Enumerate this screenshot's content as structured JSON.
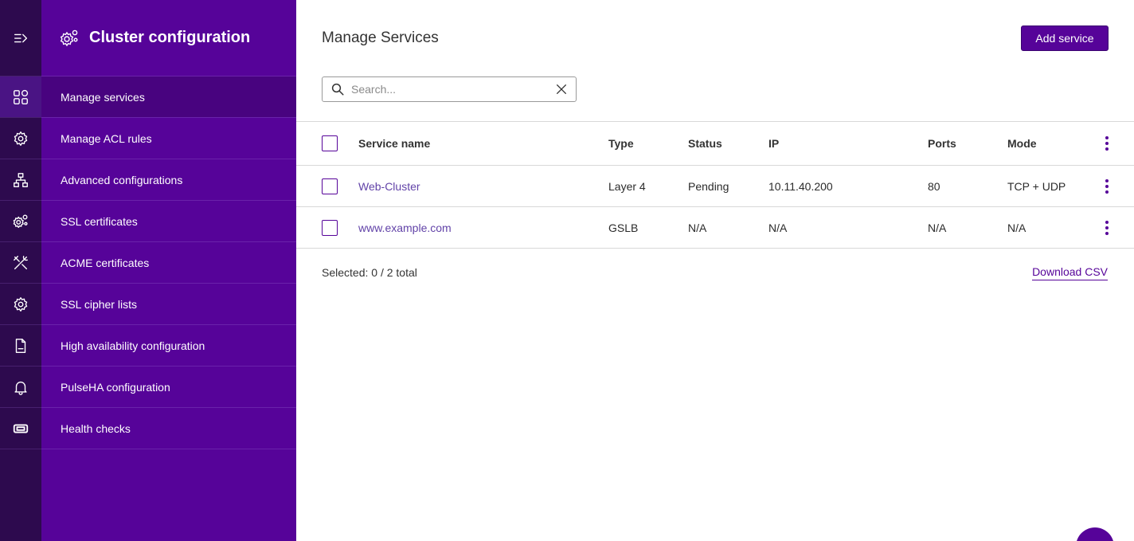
{
  "sidebar": {
    "title": "Cluster configuration",
    "items": [
      {
        "label": "Manage services",
        "icon": "grid-icon",
        "active": true
      },
      {
        "label": "Manage ACL rules",
        "icon": "gear-icon",
        "active": false
      },
      {
        "label": "Advanced configurations",
        "icon": "network-icon",
        "active": false
      },
      {
        "label": "SSL certificates",
        "icon": "gears-icon",
        "active": false
      },
      {
        "label": "ACME certificates",
        "icon": "tools-icon",
        "active": false
      },
      {
        "label": "SSL cipher lists",
        "icon": "cog-icon",
        "active": false
      },
      {
        "label": "High availability configuration",
        "icon": "log-file-icon",
        "active": false
      },
      {
        "label": "PulseHA configuration",
        "icon": "bell-icon",
        "active": false
      },
      {
        "label": "Health checks",
        "icon": "ticket-icon",
        "active": false
      }
    ]
  },
  "main": {
    "title": "Manage Services",
    "add_button": "Add service",
    "search": {
      "placeholder": "Search...",
      "value": ""
    },
    "table": {
      "headers": {
        "name": "Service name",
        "type": "Type",
        "status": "Status",
        "ip": "IP",
        "ports": "Ports",
        "mode": "Mode"
      },
      "rows": [
        {
          "name": "Web-Cluster",
          "type": "Layer 4",
          "status": "Pending",
          "ip": "10.11.40.200",
          "ports": "80",
          "mode": "TCP + UDP"
        },
        {
          "name": "www.example.com",
          "type": "GSLB",
          "status": "N/A",
          "ip": "N/A",
          "ports": "N/A",
          "mode": "N/A"
        }
      ]
    },
    "selected_text": "Selected: 0 / 2 total",
    "download_csv": "Download CSV"
  },
  "colors": {
    "brand": "#560399",
    "rail": "#2d0a4e",
    "link": "#6243a8"
  }
}
